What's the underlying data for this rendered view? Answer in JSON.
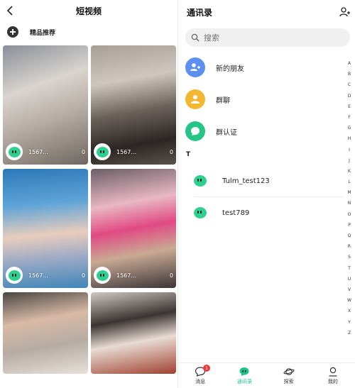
{
  "left": {
    "title": "短视频",
    "sub_label": "精品推荐",
    "cards": [
      {
        "name": "1567...",
        "count": "0"
      },
      {
        "name": "1567...",
        "count": "0"
      },
      {
        "name": "1567...",
        "count": "0"
      },
      {
        "name": "1567...",
        "count": "0"
      },
      {
        "name": "",
        "count": ""
      },
      {
        "name": "",
        "count": ""
      }
    ]
  },
  "right": {
    "title": "通讯录",
    "search": {
      "placeholder": "搜索"
    },
    "items": [
      {
        "label": "新的朋友",
        "color": "#5b8ff0"
      },
      {
        "label": "群聊",
        "color": "#f4b731"
      },
      {
        "label": "群认证",
        "color": "#26c487"
      }
    ],
    "section": "T",
    "contacts": [
      {
        "name": "Tulm_test123"
      },
      {
        "name": "test789"
      }
    ],
    "alphabet": [
      "A",
      "B",
      "C",
      "D",
      "E",
      "F",
      "G",
      "H",
      "I",
      "J",
      "K",
      "L",
      "M",
      "N",
      "O",
      "P",
      "Q",
      "R",
      "S",
      "T",
      "U",
      "V",
      "W",
      "X",
      "Y",
      "Z"
    ],
    "tabs": [
      {
        "label": "消息",
        "badge": "1"
      },
      {
        "label": "通讯录"
      },
      {
        "label": "探索"
      },
      {
        "label": "我的"
      }
    ]
  }
}
